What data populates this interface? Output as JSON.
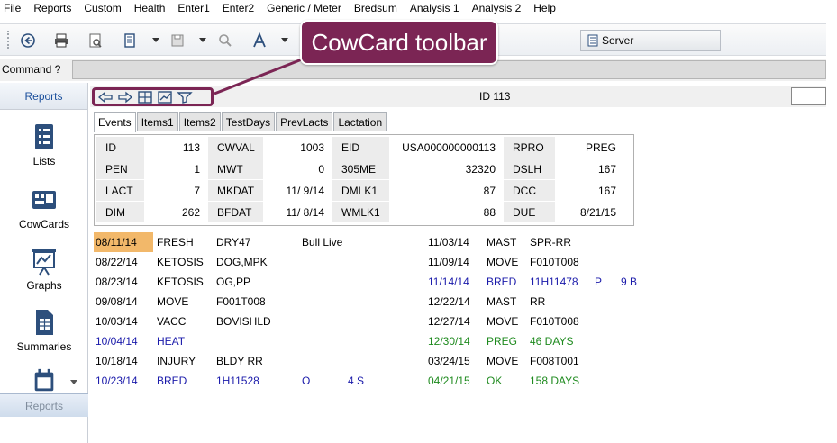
{
  "menu": [
    "File",
    "Reports",
    "Custom",
    "Health",
    "Enter1",
    "Enter2",
    "Generic / Meter",
    "Bredsum",
    "Analysis 1",
    "Analysis 2",
    "Help"
  ],
  "toolbar": {
    "server_label": "Server",
    "icons": [
      "back-icon",
      "print-icon",
      "print-preview-icon",
      "book-icon",
      "save-icon",
      "search-icon",
      "font-icon"
    ]
  },
  "command": {
    "label": "Command ?",
    "value": ""
  },
  "leftnav": {
    "header": "Reports",
    "items": [
      {
        "label": "Lists",
        "icon": "list-icon"
      },
      {
        "label": "CowCards",
        "icon": "cowcard-icon"
      },
      {
        "label": "Graphs",
        "icon": "graph-icon"
      },
      {
        "label": "Summaries",
        "icon": "summary-icon"
      }
    ],
    "footer": "Reports"
  },
  "cowcard": {
    "id_title": "ID 113",
    "tabs": [
      "Events",
      "Items1",
      "Items2",
      "TestDays",
      "PrevLacts",
      "Lactation"
    ],
    "active_tab": "Events",
    "grid": [
      [
        "ID",
        "113",
        "CWVAL",
        "1003",
        "EID",
        "USA000000000113",
        "RPRO",
        "PREG"
      ],
      [
        "PEN",
        "1",
        "MWT",
        "0",
        "305ME",
        "32320",
        "DSLH",
        "167"
      ],
      [
        "LACT",
        "7",
        "MKDAT",
        "11/ 9/14",
        "DMLK1",
        "87",
        "DCC",
        "167"
      ],
      [
        "DIM",
        "262",
        "BFDAT",
        "11/ 8/14",
        "WMLK1",
        "88",
        "DUE",
        "8/21/15"
      ]
    ],
    "events_left": [
      {
        "date": "08/11/14",
        "event": "FRESH",
        "remark": "DRY47",
        "extra": "Bull Live",
        "color": "black",
        "highlight": true
      },
      {
        "date": "08/22/14",
        "event": "KETOSIS",
        "remark": "DOG,MPK",
        "extra": "",
        "color": "black"
      },
      {
        "date": "08/23/14",
        "event": "KETOSIS",
        "remark": "OG,PP",
        "extra": "",
        "color": "black"
      },
      {
        "date": "09/08/14",
        "event": "MOVE",
        "remark": "F001T008",
        "extra": "",
        "color": "black"
      },
      {
        "date": "10/03/14",
        "event": "VACC",
        "remark": "BOVISHLD",
        "extra": "",
        "color": "black"
      },
      {
        "date": "10/04/14",
        "event": "HEAT",
        "remark": "",
        "extra": "",
        "color": "blue"
      },
      {
        "date": "10/18/14",
        "event": "INJURY",
        "remark": "BLDY RR",
        "extra": "",
        "color": "black"
      },
      {
        "date": "10/23/14",
        "event": "BRED",
        "remark": "1H11528",
        "extra": "O",
        "extra2": "4 S",
        "color": "blue"
      }
    ],
    "events_right": [
      {
        "date": "11/03/14",
        "event": "MAST",
        "remark": "SPR-RR",
        "color": "black"
      },
      {
        "date": "11/09/14",
        "event": "MOVE",
        "remark": "F010T008",
        "color": "black"
      },
      {
        "date": "11/14/14",
        "event": "BRED",
        "remark": "11H11478",
        "extra": "P",
        "extra2": "9 B",
        "color": "blue"
      },
      {
        "date": "12/22/14",
        "event": "MAST",
        "remark": "RR",
        "color": "black"
      },
      {
        "date": "12/27/14",
        "event": "MOVE",
        "remark": "F010T008",
        "color": "black"
      },
      {
        "date": "12/30/14",
        "event": "PREG",
        "remark": "46 DAYS",
        "color": "green"
      },
      {
        "date": "03/24/15",
        "event": "MOVE",
        "remark": "F008T001",
        "color": "black"
      },
      {
        "date": "04/21/15",
        "event": "OK",
        "remark": "158 DAYS",
        "color": "green"
      }
    ]
  },
  "callout": {
    "text": "CowCard toolbar",
    "color": "#7b2554"
  },
  "colors": {
    "highlight": "#f2b86a",
    "blue_event": "#1a1aaa",
    "green_event": "#1e8a1e"
  }
}
